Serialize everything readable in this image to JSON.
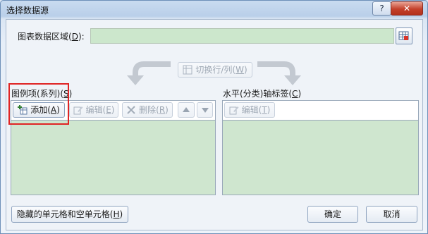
{
  "dialog": {
    "title": "选择数据源",
    "help_label": "?",
    "close_label": "✕"
  },
  "data_range": {
    "label_prefix": "图表数据区域(",
    "accel": "D",
    "label_suffix": "):",
    "value": ""
  },
  "switch_button": {
    "label_prefix": "切换行/列(",
    "accel": "W",
    "label_suffix": ")"
  },
  "legend_panel": {
    "title_prefix": "图例项(系列)(",
    "accel": "S",
    "title_suffix": ")",
    "add": {
      "prefix": "添加(",
      "accel": "A",
      "suffix": ")"
    },
    "edit": {
      "prefix": "编辑(",
      "accel": "E",
      "suffix": ")"
    },
    "delete": {
      "prefix": "删除(",
      "accel": "R",
      "suffix": ")"
    },
    "items": []
  },
  "axis_panel": {
    "title_prefix": "水平(分类)轴标签(",
    "accel": "C",
    "title_suffix": ")",
    "edit": {
      "prefix": "编辑(",
      "accel": "T",
      "suffix": ")"
    },
    "items": []
  },
  "hidden_cells_button": {
    "prefix": "隐藏的单元格和空单元格(",
    "accel": "H",
    "suffix": ")"
  },
  "ok_label": "确定",
  "cancel_label": "取消",
  "colors": {
    "list_bg": "#cfe6cf",
    "highlight": "#e02424",
    "title_gradient_top": "#c9dbf0"
  }
}
